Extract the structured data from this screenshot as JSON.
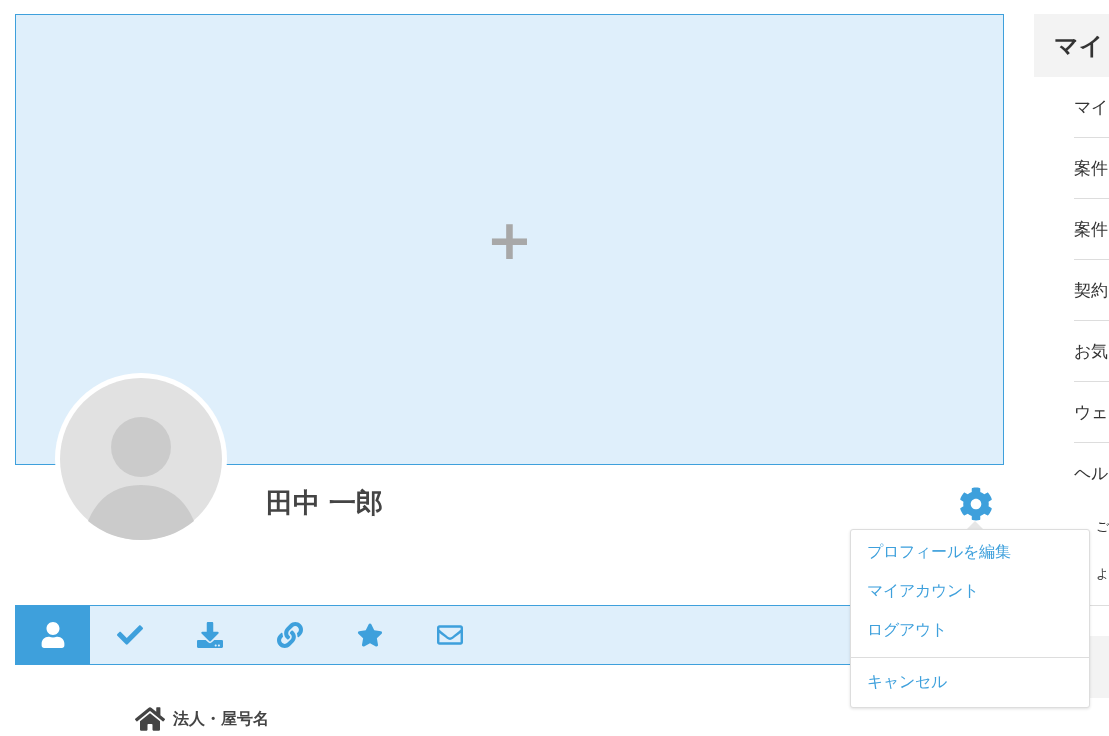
{
  "profile": {
    "name": "田中 一郎",
    "cover": {
      "add_label": "+"
    }
  },
  "settings_menu": {
    "open": true,
    "items": [
      {
        "label": "プロフィールを編集",
        "separated": false
      },
      {
        "label": "マイアカウント",
        "separated": false
      },
      {
        "label": "ログアウト",
        "separated": false
      },
      {
        "label": "キャンセル",
        "separated": true
      }
    ]
  },
  "tabs": [
    {
      "kind": "user",
      "selected": true
    },
    {
      "kind": "check",
      "selected": false
    },
    {
      "kind": "download",
      "selected": false
    },
    {
      "kind": "link",
      "selected": false
    },
    {
      "kind": "star",
      "selected": false
    },
    {
      "kind": "mail",
      "selected": false
    }
  ],
  "section": {
    "title": "法人・屋号名"
  },
  "sidebar": {
    "heading": "マイ",
    "items": [
      {
        "label": "マイ"
      },
      {
        "label": "案件"
      },
      {
        "label": "案件"
      },
      {
        "label": "契約"
      },
      {
        "label": "お気"
      },
      {
        "label": "ウェ"
      },
      {
        "label": "ヘル",
        "children": [
          "ご",
          "よ"
        ]
      }
    ]
  }
}
